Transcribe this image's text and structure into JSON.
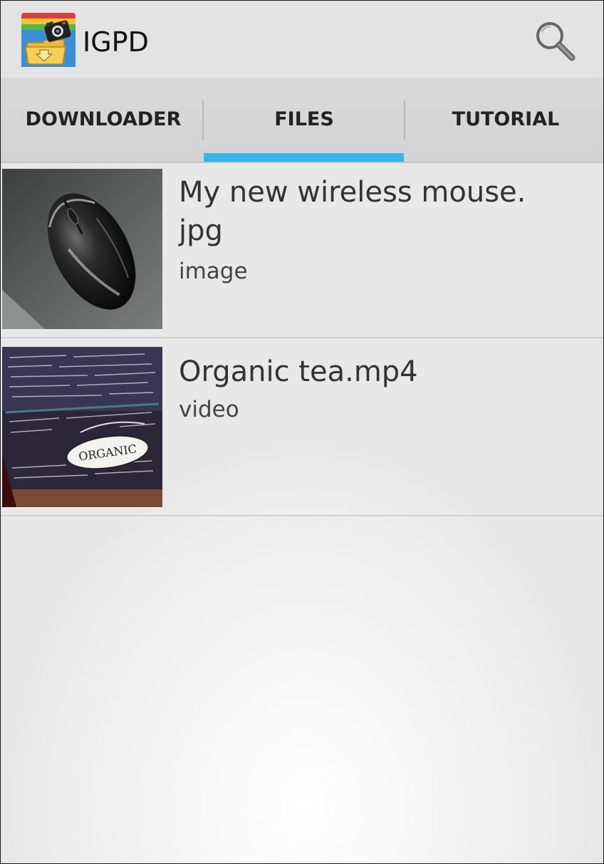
{
  "app": {
    "title": "IGPD",
    "logo_icon": "folder-camera-icon",
    "search_icon": "search-icon"
  },
  "tabs": [
    {
      "label": "DOWNLOADER",
      "selected": false
    },
    {
      "label": "FILES",
      "selected": true
    },
    {
      "label": "TUTORIAL",
      "selected": false
    }
  ],
  "files": [
    {
      "name": "My new wireless mouse.\njpg",
      "type": "image",
      "thumbnail": "computer-mouse-photo"
    },
    {
      "name": "Organic tea.mp4",
      "type": "video",
      "thumbnail": "organic-tea-box-photo"
    }
  ],
  "colors": {
    "accent": "#33b5e5",
    "action_bar": "#e3e3e3",
    "tab_bar": "#d6d6d6"
  }
}
